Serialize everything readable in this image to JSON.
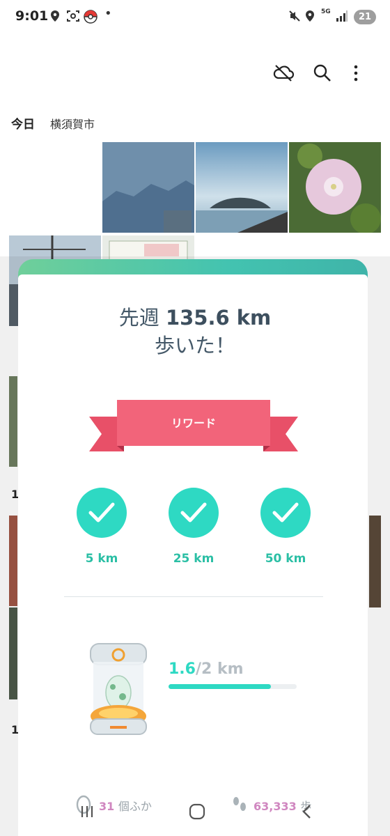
{
  "status_bar": {
    "time": "9:01",
    "network": "5G",
    "battery": "21",
    "icons": [
      "location-icon",
      "scan-icon",
      "pokeball-icon",
      "dot-icon",
      "mute-icon",
      "location-icon",
      "signal-icon"
    ]
  },
  "gallery": {
    "date_label": "今日",
    "location": "横須賀市",
    "top_icons": [
      "cloud-off-icon",
      "search-icon",
      "more-vertical-icon"
    ],
    "partial_labels": [
      "1",
      "1",
      "1"
    ]
  },
  "modal": {
    "headline_line1_prefix": "先週",
    "headline_distance": "135.6 km",
    "headline_line2": "歩いた！",
    "ribbon_label": "リワード",
    "milestones": [
      {
        "label": "5 km",
        "completed": true
      },
      {
        "label": "25 km",
        "completed": true
      },
      {
        "label": "50 km",
        "completed": true
      }
    ],
    "egg": {
      "current": "1.6",
      "total": "/2 km",
      "progress": 0.8
    },
    "stats": {
      "hatched_count": "31",
      "hatched_suffix": "個ふか",
      "steps_count": "63,333",
      "steps_suffix": "歩"
    },
    "colors": {
      "accent": "#2ed9c3",
      "ribbon": "#f2647a",
      "header_gradient_start": "#6fcf9a",
      "header_gradient_end": "#3fb4a9"
    }
  },
  "nav_bar": {
    "icons": [
      "recent-apps-icon",
      "home-icon",
      "back-icon"
    ]
  }
}
